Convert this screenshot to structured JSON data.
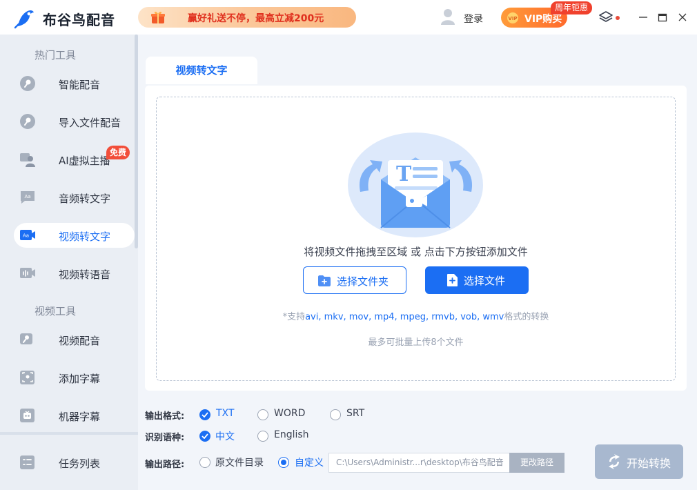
{
  "app": {
    "name": "布谷鸟配音",
    "promo_text": "赢好礼送不停，最高立减200元",
    "login": "登录",
    "vip_label": "VIP购买",
    "vip_badge": "周年钜惠",
    "accent_color": "#1b6ef3"
  },
  "sidebar": {
    "sections": [
      {
        "title": "热门工具",
        "items": [
          {
            "label": "智能配音",
            "icon": "mic-icon"
          },
          {
            "label": "导入文件配音",
            "icon": "mic-icon"
          },
          {
            "label": "AI虚拟主播",
            "icon": "avatar-host-icon",
            "badge": "免费"
          },
          {
            "label": "音频转文字",
            "icon": "text-audio-icon"
          },
          {
            "label": "视频转文字",
            "icon": "text-video-icon",
            "active": true
          },
          {
            "label": "视频转语音",
            "icon": "video-audio-icon"
          }
        ]
      },
      {
        "title": "视频工具",
        "items": [
          {
            "label": "视频配音",
            "icon": "video-mic-icon"
          },
          {
            "label": "添加字幕",
            "icon": "subtitle-icon"
          },
          {
            "label": "机器字幕",
            "icon": "robot-icon"
          }
        ]
      }
    ],
    "task_list": "任务列表"
  },
  "main": {
    "tab": "视频转文字",
    "drop_hint": "将视频文件拖拽至区域 或 点击下方按钮添加文件",
    "select_folder": "选择文件夹",
    "select_file": "选择文件",
    "formats_prefix": "*支持",
    "formats_list": "avi, mkv, mov, mp4, mpeg, rmvb, vob, wmv",
    "formats_suffix": "格式的转换",
    "limit": "最多可批量上传8个文件"
  },
  "options": {
    "format_label": "输出格式:",
    "formats": [
      {
        "label": "TXT",
        "selected": true
      },
      {
        "label": "WORD",
        "selected": false
      },
      {
        "label": "SRT",
        "selected": false
      }
    ],
    "language_label": "识别语种:",
    "languages": [
      {
        "label": "中文",
        "selected": true
      },
      {
        "label": "English",
        "selected": false
      }
    ],
    "path_label": "输出路径:",
    "path_options": [
      {
        "label": "原文件目录",
        "selected": false
      },
      {
        "label": "自定义",
        "selected": true
      }
    ],
    "path_value": "C:\\Users\\Administr...r\\desktop\\布谷鸟配音",
    "change_path": "更改路径",
    "start": "开始转换"
  }
}
